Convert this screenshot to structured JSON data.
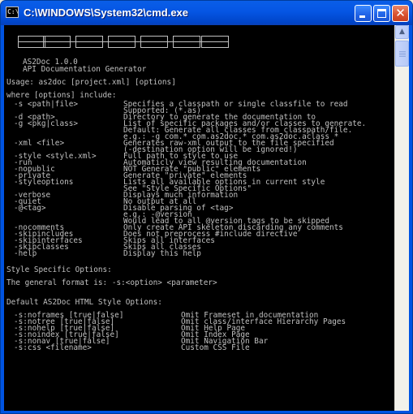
{
  "window": {
    "title": "C:\\WINDOWS\\System32\\cmd.exe",
    "icon": "cmd-icon",
    "icon_glyph": "C:\\",
    "minimize_icon": "minimize-icon",
    "maximize_icon": "maximize-icon",
    "close_icon": "close-icon",
    "close_glyph": "✕"
  },
  "console": {
    "logo": "AS2Doc",
    "version": "AS2Doc 1.0.0",
    "subtitle": "API Documentation Generator",
    "usage": "Usage: as2doc [project.xml] [options]",
    "where": "where [options] include:",
    "options": [
      {
        "flag": "-s <path|file>",
        "desc": "Specifies a classpath or single classfile to read"
      },
      {
        "flag": "",
        "desc": "Supported: (*.as)"
      },
      {
        "flag": "-d <path>",
        "desc": "Directory to generate the documentation to"
      },
      {
        "flag": "-g <pkg|class>",
        "desc": "List of specific packages and/or classes to generate."
      },
      {
        "flag": "",
        "desc": "Default: Generate all classes from classpath/file."
      },
      {
        "flag": "",
        "desc": "e.g.: -g com.* com.as2doc.* com.as2doc.aclass *"
      },
      {
        "flag": "-xml <file>",
        "desc": "Generates raw-xml output to the file specified"
      },
      {
        "flag": "",
        "desc": "(-destination option will be ignored!)"
      },
      {
        "flag": "-style <style.xml>",
        "desc": "Full path to style to use"
      },
      {
        "flag": "-run",
        "desc": "Automaticly view resulting documentation"
      },
      {
        "flag": "-nopublic",
        "desc": "NOT Generate \"public\" elements"
      },
      {
        "flag": "-private",
        "desc": "Generate \"private\" elements"
      },
      {
        "flag": "-styleoptions",
        "desc": "Lists all available options in current style"
      },
      {
        "flag": "",
        "desc": "See \"Style Specific Options\""
      },
      {
        "flag": "-verbose",
        "desc": "Displays much information"
      },
      {
        "flag": "-quiet",
        "desc": "No output at all"
      },
      {
        "flag": "-@<tag>",
        "desc": "Disable parsing of <tag>"
      },
      {
        "flag": "",
        "desc": "e.g.: -@version"
      },
      {
        "flag": "",
        "desc": "Would lead to all @version tags to be skipped"
      },
      {
        "flag": "-nocomments",
        "desc": "Only create API skeleton discarding any comments"
      },
      {
        "flag": "-skipincludes",
        "desc": "Does not preprocess #include directive"
      },
      {
        "flag": "-skipinterfaces",
        "desc": "Skips all interfaces"
      },
      {
        "flag": "-skipclasses",
        "desc": "Skips all classes"
      },
      {
        "flag": "-help",
        "desc": "Display this help"
      }
    ],
    "style_specific": "Style Specific Options:",
    "general_format": "The general format is: -s:<option> <parameter>",
    "default_style": "Default AS2Doc HTML Style Options:",
    "style_options": [
      {
        "flag": "-s:noframes [true|false]",
        "desc": "Omit Frameset in documentation"
      },
      {
        "flag": "-s:notree [true|false]",
        "desc": "Omit class/interface Hierarchy Pages"
      },
      {
        "flag": "-s:nohelp [true|false]",
        "desc": "Omit Help Page"
      },
      {
        "flag": "-s:noindex [true|false]",
        "desc": "Omit Index Page"
      },
      {
        "flag": "-s:nonav [true|false]",
        "desc": "Omit Navigation Bar"
      },
      {
        "flag": "-s:css <filename>",
        "desc": "Custom CSS File"
      }
    ]
  },
  "scrollbar": {
    "up_icon": "scroll-up-icon",
    "up_glyph": "▲",
    "position": 0
  },
  "colors": {
    "console_bg": "#000000",
    "console_text": "#c0c0c0",
    "titlebar": "#0054e3"
  }
}
